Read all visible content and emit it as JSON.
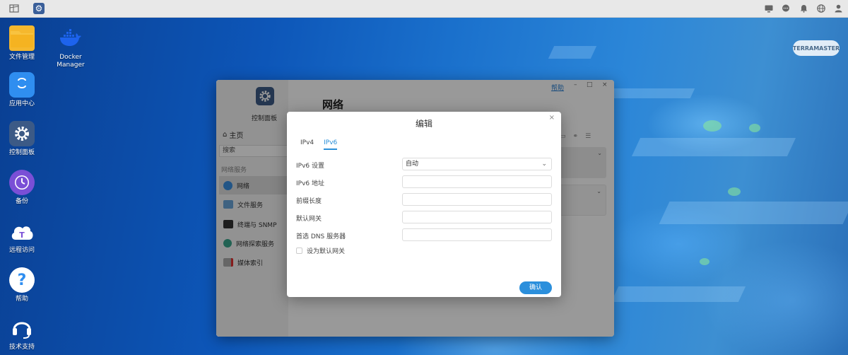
{
  "desktop": {
    "brand_logo": "TERRAMASTER",
    "icons": [
      {
        "label": "文件管理",
        "icon": "folder-icon"
      },
      {
        "label": "Docker Manager",
        "icon": "docker-icon"
      },
      {
        "label": "应用中心",
        "icon": "shopping-bag-icon"
      },
      {
        "label": "控制面板",
        "icon": "gear-icon"
      },
      {
        "label": "备份",
        "icon": "clock-icon"
      },
      {
        "label": "远程访问",
        "icon": "cloud-icon"
      },
      {
        "label": "帮助",
        "icon": "question-icon"
      },
      {
        "label": "技术支持",
        "icon": "headset-icon"
      }
    ]
  },
  "topbar": {
    "left_icons": [
      "window-icon",
      "control-panel-icon"
    ],
    "right_icons": [
      "monitor-icon",
      "chat-icon",
      "bell-icon",
      "globe-icon",
      "user-icon"
    ]
  },
  "control_panel": {
    "app_title": "控制面板",
    "help_link": "帮助",
    "section_title": "网络",
    "home": "主页",
    "search_placeholder": "搜索",
    "group_label": "网络服务",
    "sidebar": [
      {
        "label": "网络",
        "icon": "globe-icon",
        "active": true
      },
      {
        "label": "文件服务",
        "icon": "file-service-icon"
      },
      {
        "label": "终端与 SNMP",
        "icon": "terminal-icon"
      },
      {
        "label": "网络探索服务",
        "icon": "search-icon"
      },
      {
        "label": "媒体索引",
        "icon": "media-index-icon"
      }
    ]
  },
  "dialog": {
    "title": "编辑",
    "close_icon": "×",
    "tabs": [
      "IPv4",
      "IPv6"
    ],
    "active_tab": "IPv6",
    "fields": [
      {
        "label": "IPv6 设置",
        "value": "自动",
        "type": "select"
      },
      {
        "label": "IPv6 地址",
        "value": ""
      },
      {
        "label": "前缀长度",
        "value": ""
      },
      {
        "label": "默认网关",
        "value": ""
      },
      {
        "label": "首选 DNS 服务器",
        "value": ""
      }
    ],
    "checkbox_label": "设为默认网关",
    "checkbox_checked": false,
    "confirm_button": "确认"
  },
  "colors": {
    "accent": "#2b8fdc",
    "desktop_bg": "#0d56b8"
  }
}
